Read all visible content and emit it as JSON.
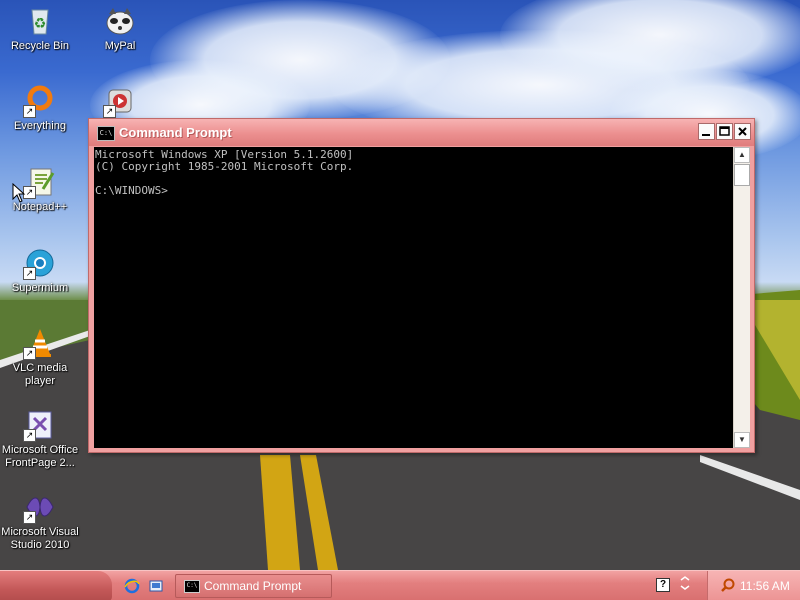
{
  "desktop": {
    "icons": [
      {
        "label": "Recycle Bin",
        "icon": "recycle-bin-icon"
      },
      {
        "label": "MyPal",
        "icon": "mypal-icon"
      },
      {
        "label": "Everything",
        "icon": "everything-icon"
      },
      {
        "label": "Notepad++",
        "icon": "notepad-plus-plus-icon"
      },
      {
        "label": "Supermium",
        "icon": "supermium-icon"
      },
      {
        "label": "VLC media player",
        "icon": "vlc-icon"
      },
      {
        "label": "Microsoft Office FrontPage 2...",
        "icon": "frontpage-icon"
      },
      {
        "label": "Microsoft Visual Studio 2010",
        "icon": "visual-studio-icon"
      }
    ]
  },
  "window": {
    "title": "Command Prompt",
    "icon_text": "C:\\",
    "console_lines": [
      "Microsoft Windows XP [Version 5.1.2600]",
      "(C) Copyright 1985-2001 Microsoft Corp.",
      "",
      "C:\\WINDOWS>"
    ]
  },
  "taskbar": {
    "tasks": [
      {
        "label": "Command Prompt",
        "icon_text": "C:\\"
      }
    ],
    "clock": "11:56 AM",
    "help_label": "?"
  },
  "colors": {
    "window_frame": "#f0a0a0",
    "taskbar": "#e37f7f",
    "console_bg": "#000000",
    "console_fg": "#c0c0c0"
  }
}
